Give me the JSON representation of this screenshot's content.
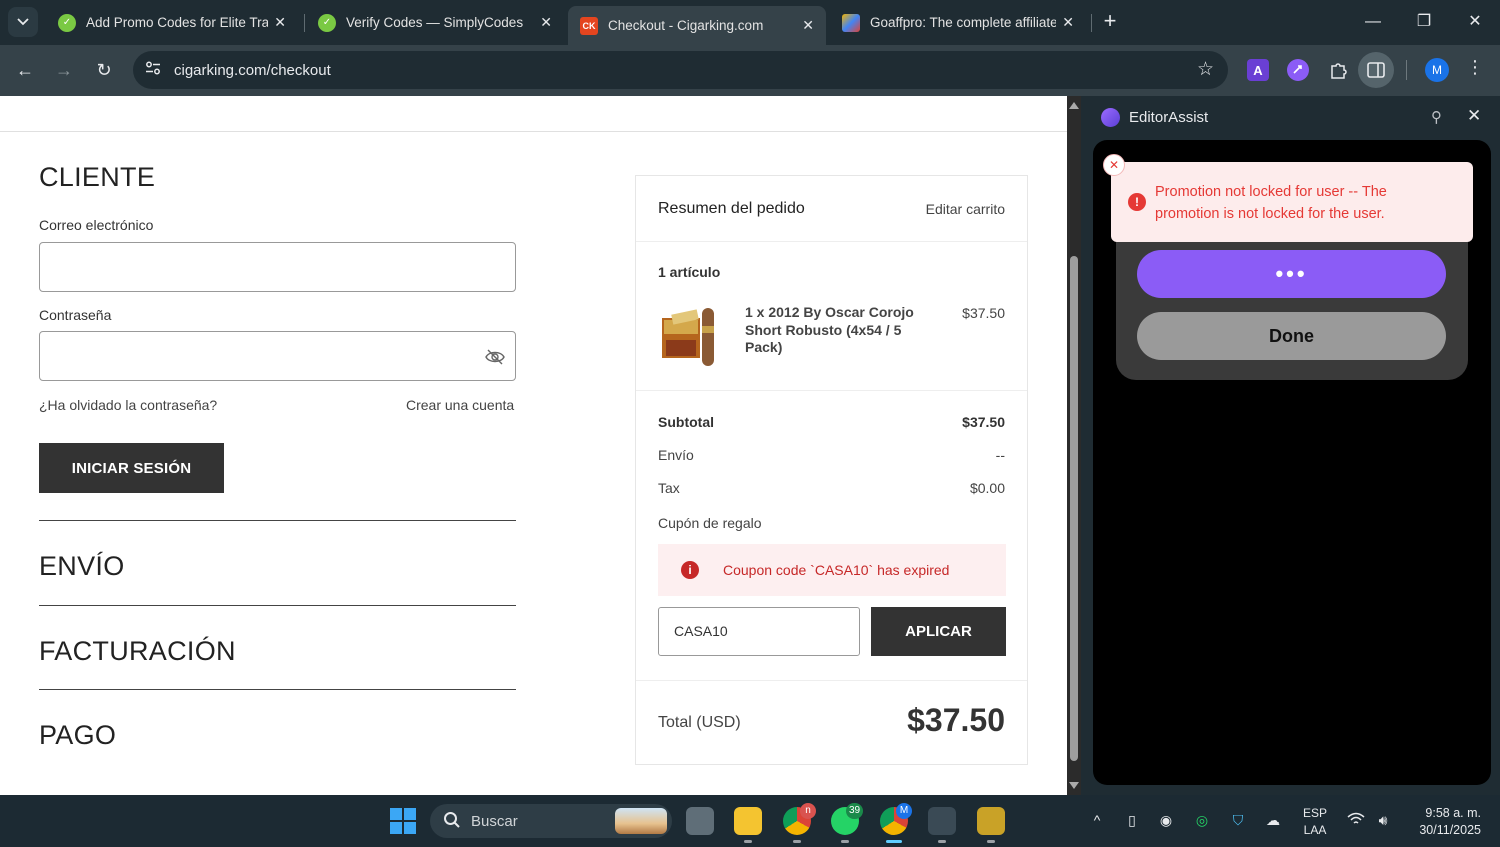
{
  "browser": {
    "tabs": [
      {
        "title": "Add Promo Codes for Elite Trad",
        "active": false
      },
      {
        "title": "Verify Codes — SimplyCodes",
        "active": false
      },
      {
        "title": "Checkout - Cigarking.com",
        "active": true,
        "favicon_text": "CK"
      },
      {
        "title": "Goaffpro: The complete affiliate",
        "active": false
      }
    ],
    "url": "cigarking.com/checkout",
    "avatar_initial": "M",
    "extension_letter": "A"
  },
  "checkout": {
    "cliente_heading": "CLIENTE",
    "email_label": "Correo electrónico",
    "email_value": "",
    "password_label": "Contraseña",
    "password_value": "",
    "forgot_password": "¿Ha olvidado la contraseña?",
    "create_account": "Crear una cuenta",
    "login_button": "INICIAR SESIÓN",
    "envio_heading": "ENVÍO",
    "facturacion_heading": "FACTURACIÓN",
    "pago_heading": "PAGO"
  },
  "summary": {
    "title": "Resumen del pedido",
    "edit_cart": "Editar carrito",
    "item_count": "1 artículo",
    "product_name": "1 x 2012 By Oscar Corojo Short Robusto (4x54 / 5 Pack)",
    "product_price": "$37.50",
    "subtotal_label": "Subtotal",
    "subtotal_value": "$37.50",
    "shipping_label": "Envío",
    "shipping_value": "--",
    "tax_label": "Tax",
    "tax_value": "$0.00",
    "coupon_label": "Cupón de regalo",
    "coupon_error": "Coupon code `CASA10` has expired",
    "coupon_value": "CASA10",
    "apply_button": "APLICAR",
    "total_label": "Total (USD)",
    "total_value": "$37.50"
  },
  "side_panel": {
    "title": "EditorAssist",
    "toast_message": "Promotion not locked for user -- The promotion is not locked for the user.",
    "loading_label": "•••",
    "done_button": "Done"
  },
  "taskbar": {
    "search_placeholder": "Buscar",
    "chrome_badge": "n",
    "whatsapp_badge": "39",
    "chrome2_badge": "M",
    "language": "ESP",
    "layout": "LAA",
    "time": "9:58 a. m.",
    "date": "30/11/2025"
  },
  "colors": {
    "accent_purple": "#8b5cf6",
    "error_red": "#c62828",
    "dark_button": "#333333"
  }
}
